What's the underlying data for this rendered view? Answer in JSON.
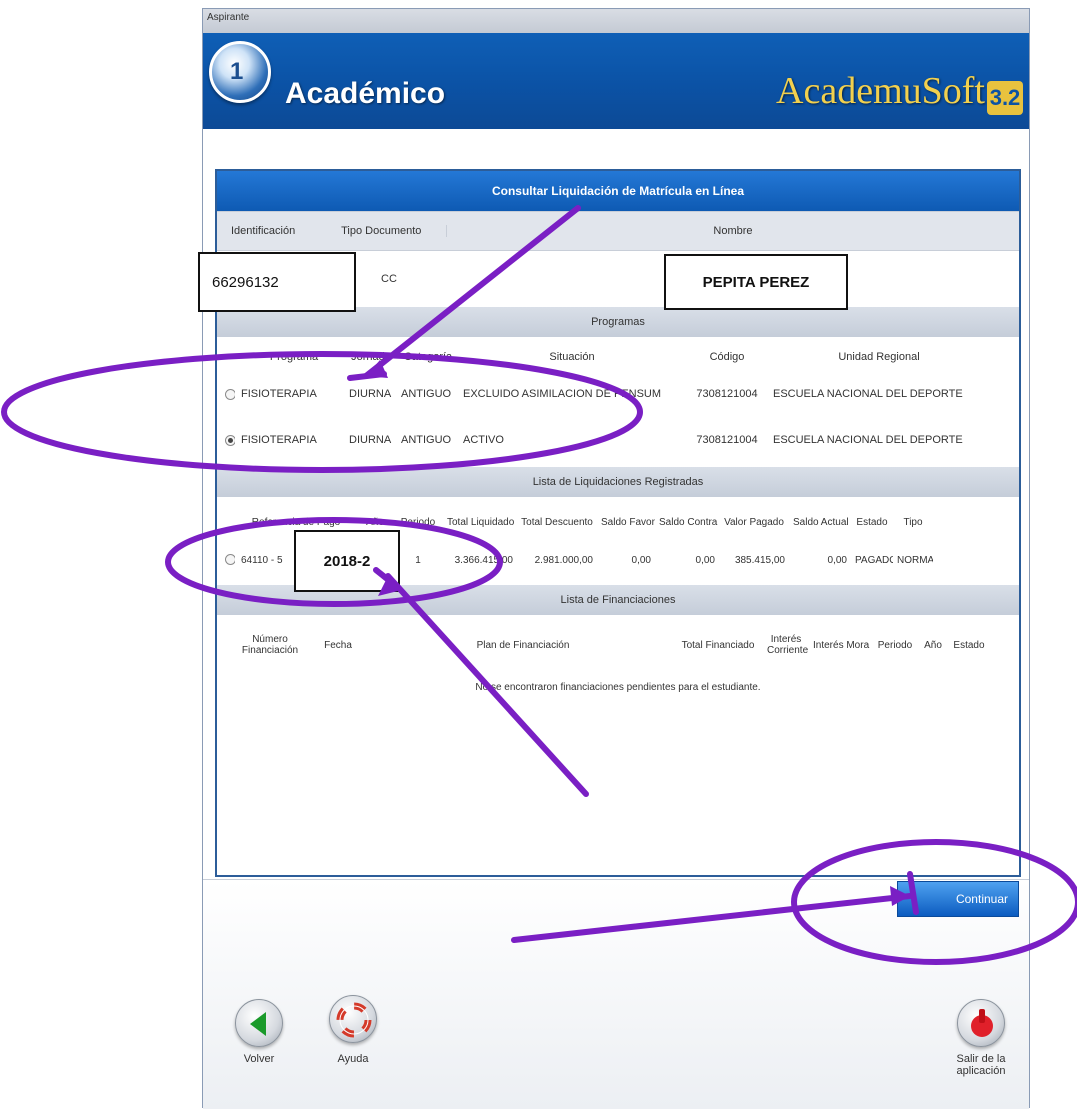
{
  "window": {
    "title": "Aspirante"
  },
  "header": {
    "app_title": "Académico",
    "brand": "AcademuSoft",
    "brand_version": "3.2"
  },
  "panel": {
    "title": "Consultar Liquidación de Matrícula en Línea",
    "student_columns": [
      "Identificación",
      "Tipo Documento",
      "Nombre"
    ],
    "student": {
      "doc_type": "CC"
    },
    "programs_title": "Programas",
    "program_columns": [
      "Programa",
      "Jornada",
      "Categoría",
      "Situación",
      "Código",
      "Unidad Regional"
    ],
    "programs": [
      {
        "selected": false,
        "program": "FISIOTERAPIA",
        "jornada": "DIURNA",
        "categoria": "ANTIGUO",
        "situacion": "EXCLUIDO ASIMILACION DE PENSUM",
        "codigo": "7308121004",
        "unidad": "ESCUELA NACIONAL DEL DEPORTE"
      },
      {
        "selected": true,
        "program": "FISIOTERAPIA",
        "jornada": "DIURNA",
        "categoria": "ANTIGUO",
        "situacion": "ACTIVO",
        "codigo": "7308121004",
        "unidad": "ESCUELA NACIONAL DEL DEPORTE"
      }
    ],
    "liquidations_title": "Lista de Liquidaciones Registradas",
    "liquidation_columns": [
      "Referencia de Pago",
      "Año",
      "Periodo",
      "Total Liquidado",
      "Total Descuento",
      "Saldo Favor",
      "Saldo Contra",
      "Valor Pagado",
      "Saldo Actual",
      "Estado",
      "Tipo"
    ],
    "liquidations": [
      {
        "ref": "64110 - 5",
        "anio": "",
        "periodo": "1",
        "total_liquidado": "3.366.415,00",
        "total_descuento": "2.981.000,00",
        "saldo_favor": "0,00",
        "saldo_contra": "0,00",
        "valor_pagado": "385.415,00",
        "saldo_actual": "0,00",
        "estado": "PAGADO",
        "tipo": "NORMAL"
      }
    ],
    "financing_title": "Lista de Financiaciones",
    "financing_columns": [
      "Número Financiación",
      "Fecha",
      "Plan de Financiación",
      "Total Financiado",
      "Interés Corriente",
      "Interés Mora",
      "Periodo",
      "Año",
      "Estado"
    ],
    "financing_empty": "No se encontraron financiaciones pendientes para el estudiante."
  },
  "buttons": {
    "continue": "Continuar",
    "back": "Volver",
    "help": "Ayuda",
    "exit": "Salir de la aplicación"
  },
  "annotations": {
    "id_callout": "66296132",
    "name_callout": "PEPITA PEREZ",
    "year_callout": "2018-2",
    "color": "#7a1fc4"
  }
}
